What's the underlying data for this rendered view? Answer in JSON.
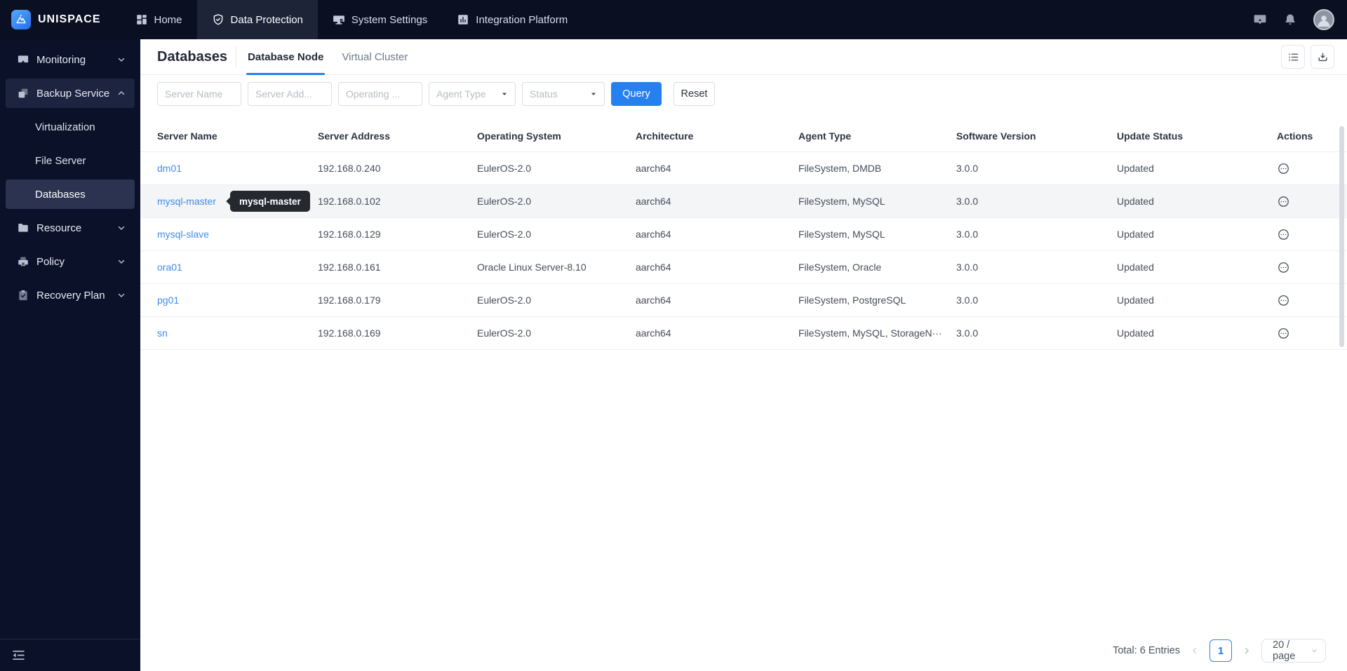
{
  "brand": {
    "name": "UNISPACE"
  },
  "topnav": {
    "items": [
      {
        "label": "Home",
        "active": false
      },
      {
        "label": "Data Protection",
        "active": true
      },
      {
        "label": "System Settings",
        "active": false
      },
      {
        "label": "Integration Platform",
        "active": false
      }
    ]
  },
  "icons": {
    "topbar_right": [
      "message-icon",
      "bell-icon",
      "user-avatar"
    ],
    "toolbar": [
      "list-view-icon",
      "download-icon"
    ],
    "row_action": "ellipsis-circle-icon",
    "sidebar_footer": "collapse-sidebar-icon"
  },
  "sidebar": {
    "items": [
      {
        "label": "Monitoring"
      },
      {
        "label": "Backup Service",
        "active": true,
        "expanded": true
      },
      {
        "label": "Virtualization",
        "sub": true
      },
      {
        "label": "File Server",
        "sub": true
      },
      {
        "label": "Databases",
        "sub": true,
        "selected": true
      },
      {
        "label": "Resource"
      },
      {
        "label": "Policy"
      },
      {
        "label": "Recovery Plan"
      }
    ]
  },
  "page": {
    "title": "Databases",
    "tabs": [
      {
        "label": "Database Node",
        "active": true
      },
      {
        "label": "Virtual Cluster",
        "active": false
      }
    ]
  },
  "filters": {
    "server_name_placeholder": "Server Name",
    "server_address_placeholder": "Server Add...",
    "operating_system_placeholder": "Operating ...",
    "agent_type_placeholder": "Agent Type",
    "status_placeholder": "Status",
    "query_label": "Query",
    "reset_label": "Reset"
  },
  "table": {
    "columns": [
      "Server Name",
      "Server Address",
      "Operating System",
      "Architecture",
      "Agent Type",
      "Software Version",
      "Update Status",
      "Actions"
    ],
    "rows": [
      {
        "server_name": "dm01",
        "server_address": "192.168.0.240",
        "os": "EulerOS-2.0",
        "arch": "aarch64",
        "agent_type": "FileSystem, DMDB",
        "version": "3.0.0",
        "update_status": "Updated"
      },
      {
        "server_name": "mysql-master",
        "server_address": "192.168.0.102",
        "os": "EulerOS-2.0",
        "arch": "aarch64",
        "agent_type": "FileSystem, MySQL",
        "version": "3.0.0",
        "update_status": "Updated",
        "hovered": true
      },
      {
        "server_name": "mysql-slave",
        "server_address": "192.168.0.129",
        "os": "EulerOS-2.0",
        "arch": "aarch64",
        "agent_type": "FileSystem, MySQL",
        "version": "3.0.0",
        "update_status": "Updated"
      },
      {
        "server_name": "ora01",
        "server_address": "192.168.0.161",
        "os": "Oracle Linux Server-8.10",
        "arch": "aarch64",
        "agent_type": "FileSystem, Oracle",
        "version": "3.0.0",
        "update_status": "Updated"
      },
      {
        "server_name": "pg01",
        "server_address": "192.168.0.179",
        "os": "EulerOS-2.0",
        "arch": "aarch64",
        "agent_type": "FileSystem, PostgreSQL",
        "version": "3.0.0",
        "update_status": "Updated"
      },
      {
        "server_name": "sn",
        "server_address": "192.168.0.169",
        "os": "EulerOS-2.0",
        "arch": "aarch64",
        "agent_type": "FileSystem, MySQL, StorageN···",
        "version": "3.0.0",
        "update_status": "Updated"
      }
    ]
  },
  "tooltip": {
    "text": "mysql-master"
  },
  "pagination": {
    "total_label": "Total: 6 Entries",
    "current_page": "1",
    "page_size": "20 / page"
  },
  "colors": {
    "accent": "#2680f0",
    "link": "#3f8ce8",
    "topbar_bg": "#0a0f22",
    "sidebar_bg": "#0b1129",
    "topnav_active_bg": "#1d2438",
    "sidebar_selected_bg": "#2b3350",
    "tooltip_bg": "#25292f"
  }
}
